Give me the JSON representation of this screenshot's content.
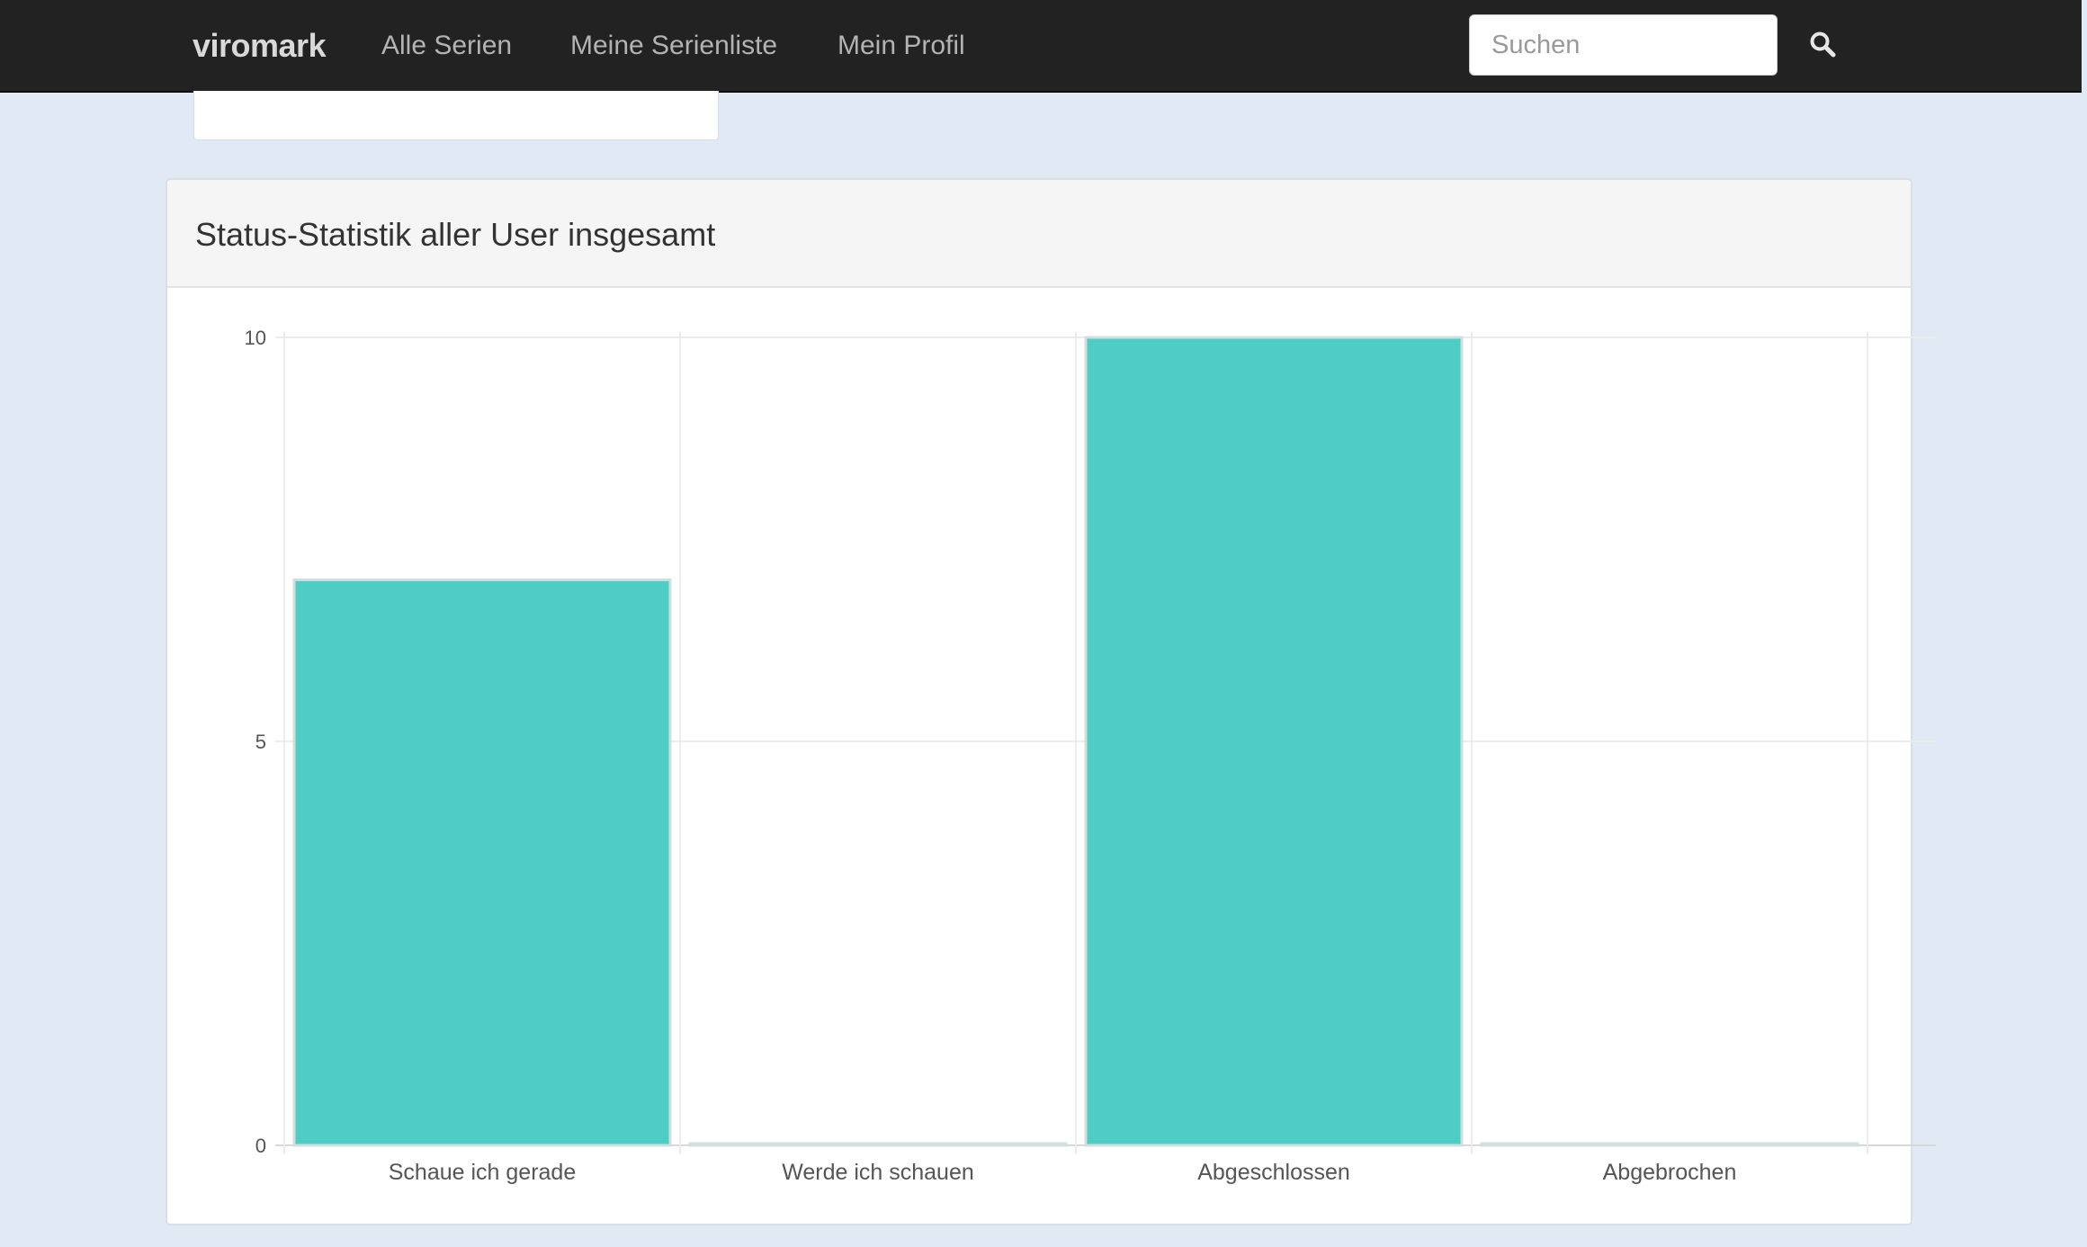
{
  "navbar": {
    "brand": "viromark",
    "links": [
      "Alle Serien",
      "Meine Serienliste",
      "Mein Profil"
    ],
    "search_placeholder": "Suchen",
    "search_value": ""
  },
  "panel": {
    "title": "Status-Statistik aller User insgesamt"
  },
  "colors": {
    "navbar_bg": "#222222",
    "page_bg": "#e1eaf4",
    "bar_fill": "#4ecdc4",
    "bar_stroke": "#d0dfdd"
  },
  "icons": {
    "search": "search-icon"
  },
  "chart_data": {
    "type": "bar",
    "title": "",
    "categories": [
      "Schaue ich gerade",
      "Werde ich schauen",
      "Abgeschlossen",
      "Abgebrochen"
    ],
    "values": [
      7,
      0,
      10,
      0
    ],
    "ylim": [
      0,
      10
    ],
    "yticks": [
      0,
      5,
      10
    ],
    "xlabel": "",
    "ylabel": "",
    "grid": true,
    "legend": "none"
  }
}
